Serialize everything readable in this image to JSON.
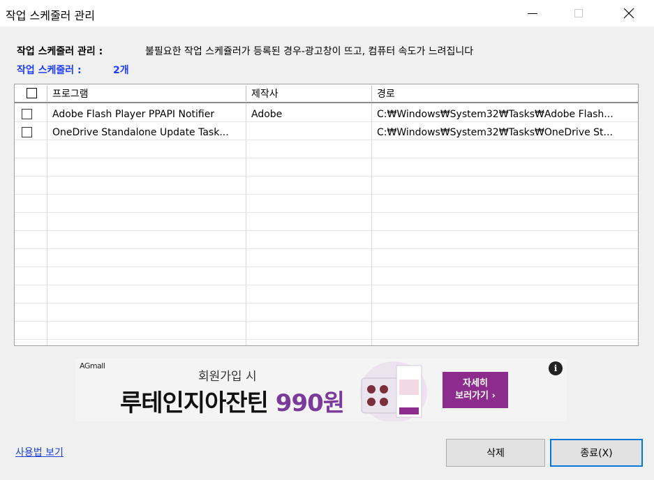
{
  "window": {
    "title": "작업 스케줄러 관리",
    "controls": [
      "minimize-icon",
      "maximize-icon",
      "close-icon"
    ]
  },
  "info": {
    "desc_label": "작업 스케줄러 관리 :",
    "desc_text": "불필요한 작업 스케쥴러가 등록된 경우-광고창이 뜨고, 컴퓨터 속도가 느려집니다",
    "count_label": "작업 스케줄러 :",
    "count_value": "2개",
    "accent_color": "#1e3cff"
  },
  "table": {
    "columns": [
      "프로그램",
      "제작사",
      "경로"
    ],
    "header_checkbox_checked": false,
    "rows": [
      {
        "checked": false,
        "program": "Adobe Flash Player PPAPI Notifier",
        "maker": "Adobe",
        "path": "C:₩Windows₩System32₩Tasks₩Adobe Flash..."
      },
      {
        "checked": false,
        "program": "OneDrive Standalone Update Task...",
        "maker": "",
        "path": "C:₩Windows₩System32₩Tasks₩OneDrive St..."
      }
    ]
  },
  "ad": {
    "brand": "AGmall",
    "line1": "회원가입 시",
    "line2_main": "루테인지아잔틴 ",
    "line2_price": "990원",
    "button_line1": "자세히",
    "button_line2": "보러가기 ›",
    "info_glyph": "i",
    "button_color": "#8c2d8e"
  },
  "footer": {
    "help_link": "사용법 보기",
    "delete_button": "삭제",
    "close_button": "종료(X)"
  }
}
